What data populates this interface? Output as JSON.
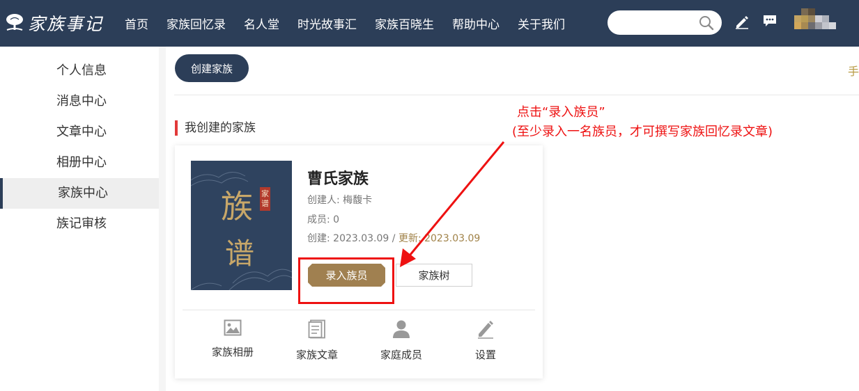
{
  "header": {
    "logo_text": "家族事记",
    "nav": [
      "首页",
      "家族回忆录",
      "名人堂",
      "时光故事汇",
      "家族百晓生",
      "帮助中心",
      "关于我们"
    ],
    "search": {
      "value": "",
      "placeholder": ""
    }
  },
  "sidebar": {
    "items": [
      {
        "label": "个人信息"
      },
      {
        "label": "消息中心"
      },
      {
        "label": "文章中心"
      },
      {
        "label": "相册中心"
      },
      {
        "label": "家族中心",
        "active": true
      },
      {
        "label": "族记审核"
      }
    ]
  },
  "main": {
    "create_button": "创建家族",
    "edge_mark": "手",
    "section_title": "我创建的家族",
    "family": {
      "cover_title_1": "族",
      "cover_title_2": "谱",
      "cover_seal": "家谱",
      "name": "曹氏家族",
      "creator": "创建人: 梅馥卡",
      "members": "成员: 0",
      "created": "创建: 2023.03.09",
      "sep": " / ",
      "updated": "更新: 2023.03.09",
      "btn_record": "录入族员",
      "btn_tree": "家族树",
      "actions": [
        "家族相册",
        "家族文章",
        "家庭成员",
        "设置"
      ]
    }
  },
  "annotation": {
    "line1": "点击“录入族员”",
    "line2": "(至少录入一名族员，才可撰写家族回忆录文章)",
    "color": "#ee1111"
  },
  "colors": {
    "header_bg": "#2c3e58",
    "accent_gold": "#a08050",
    "section_bar": "#e23a3a"
  }
}
